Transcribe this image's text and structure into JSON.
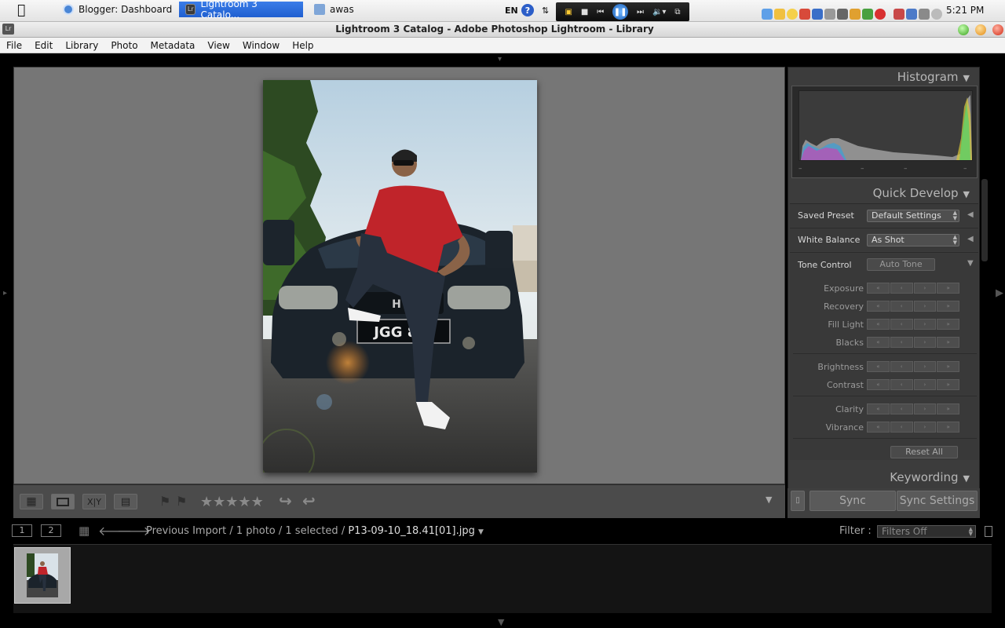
{
  "os": {
    "tasks": [
      {
        "label": "Blogger: Dashboard"
      },
      {
        "label": "Lightroom 3 Catalo..."
      },
      {
        "label": "awas"
      }
    ],
    "lang": "EN",
    "clock": "5:21 PM"
  },
  "window": {
    "title": "Lightroom 3 Catalog - Adobe Photoshop Lightroom - Library",
    "badge": "Lr"
  },
  "menu": [
    "File",
    "Edit",
    "Library",
    "Photo",
    "Metadata",
    "View",
    "Window",
    "Help"
  ],
  "photo": {
    "plate": "JGG 87"
  },
  "panel": {
    "histogram": "Histogram",
    "quick_develop": "Quick Develop",
    "saved_preset_label": "Saved Preset",
    "saved_preset_value": "Default Settings",
    "white_balance_label": "White Balance",
    "white_balance_value": "As Shot",
    "tone_control_label": "Tone Control",
    "auto_tone": "Auto Tone",
    "adjustments": {
      "exposure": "Exposure",
      "recovery": "Recovery",
      "fill_light": "Fill Light",
      "blacks": "Blacks",
      "brightness": "Brightness",
      "contrast": "Contrast",
      "clarity": "Clarity",
      "vibrance": "Vibrance"
    },
    "reset_all": "Reset All",
    "keywording": "Keywording",
    "sync": "Sync",
    "sync_settings": "Sync Settings"
  },
  "filmstrip": {
    "monitor1": "1",
    "monitor2": "2",
    "source_path": "Previous Import / 1 photo / 1 selected /",
    "filename": "P13-09-10_18.41[01].jpg",
    "filter_label": "Filter :",
    "filter_value": "Filters Off"
  },
  "colors": {
    "panel_bg": "#3c3c3c",
    "view_bg": "#767676",
    "accent_task": "#2a6ad8"
  }
}
